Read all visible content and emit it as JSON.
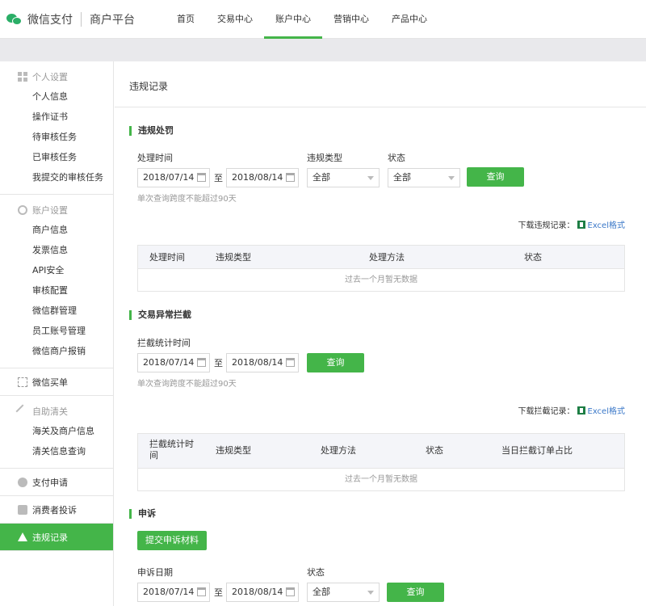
{
  "header": {
    "brand": "微信支付",
    "subbrand": "商户平台",
    "nav": [
      {
        "label": "首页"
      },
      {
        "label": "交易中心"
      },
      {
        "label": "账户中心"
      },
      {
        "label": "营销中心"
      },
      {
        "label": "产品中心"
      }
    ],
    "active_nav": "账户中心"
  },
  "sidebar": {
    "personal": {
      "title": "个人设置",
      "items": [
        "个人信息",
        "操作证书",
        "待审核任务",
        "已审核任务",
        "我提交的审核任务"
      ]
    },
    "account": {
      "title": "账户设置",
      "items": [
        "商户信息",
        "发票信息",
        "API安全",
        "审核配置",
        "微信群管理",
        "员工账号管理",
        "微信商户报销"
      ]
    },
    "wechat_bill": "微信买单",
    "customs": {
      "title": "自助清关",
      "items": [
        "海关及商户信息",
        "清关信息查询"
      ]
    },
    "pay_apply": "支付申请",
    "complaint": "消费者投诉",
    "violation": "违规记录"
  },
  "main": {
    "page_title": "违规记录",
    "penalty": {
      "title": "违规处罚",
      "time_label": "处理时间",
      "start_date": "2018/07/14",
      "to": "至",
      "end_date": "2018/08/14",
      "type_label": "违规类型",
      "type_value": "全部",
      "status_label": "状态",
      "status_value": "全部",
      "query_btn": "查询",
      "hint": "单次查询跨度不能超过90天",
      "download_prefix": "下载违规记录：",
      "download_link": "Excel格式",
      "columns": [
        "处理时间",
        "违规类型",
        "处理方法",
        "状态"
      ],
      "empty": "过去一个月暂无数据"
    },
    "intercept": {
      "title": "交易异常拦截",
      "time_label": "拦截统计时间",
      "start_date": "2018/07/14",
      "to": "至",
      "end_date": "2018/08/14",
      "query_btn": "查询",
      "hint": "单次查询跨度不能超过90天",
      "download_prefix": "下载拦截记录：",
      "download_link": "Excel格式",
      "columns": [
        "拦截统计时间",
        "违规类型",
        "处理方法",
        "状态",
        "当日拦截订单占比"
      ],
      "empty": "过去一个月暂无数据"
    },
    "appeal": {
      "title": "申诉",
      "submit_btn": "提交申诉材料",
      "date_label": "申诉日期",
      "start_date": "2018/07/14",
      "to": "至",
      "end_date": "2018/08/14",
      "status_label": "状态",
      "status_value": "全部",
      "query_btn": "查询"
    }
  },
  "colors": {
    "accent": "#44b549",
    "link": "#3b78c8"
  }
}
